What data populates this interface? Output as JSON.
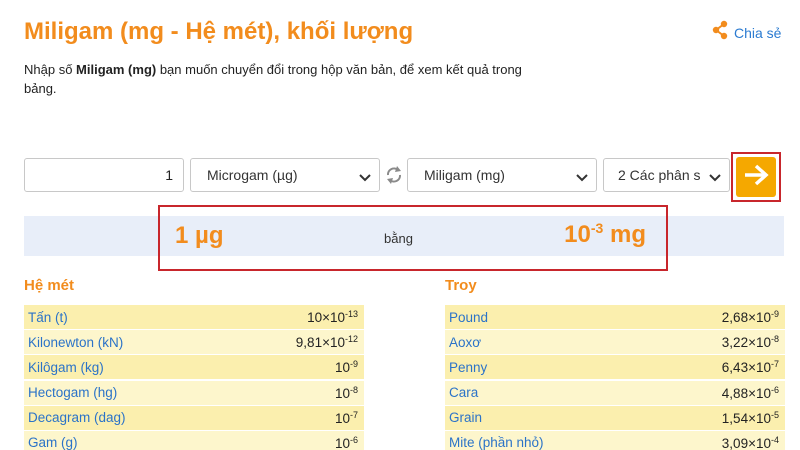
{
  "header": {
    "title": "Miligam (mg - Hệ mét), khối lượng",
    "share_label": "Chia sẻ"
  },
  "intro": {
    "before": "Nhập số ",
    "bold": "Miligam (mg)",
    "after": " bạn muốn chuyển đổi trong hộp văn bản, để xem kết quả trong bảng."
  },
  "converter": {
    "input_value": "1",
    "from_unit": "Microgam (µg)",
    "to_unit": "Miligam (mg)",
    "precision": "2 Các phân s"
  },
  "result": {
    "from_text": "1 µg",
    "equals_label": "bằng",
    "to_base": "10",
    "to_exponent": "-3",
    "to_unit": "mg"
  },
  "metric": {
    "title": "Hệ mét",
    "rows": [
      {
        "unit": "Tấn (t)",
        "mant": "10×10",
        "exp": "-13"
      },
      {
        "unit": "Kilonewton (kN)",
        "mant": "9,81×10",
        "exp": "-12"
      },
      {
        "unit": "Kilôgam (kg)",
        "mant": "10",
        "exp": "-9"
      },
      {
        "unit": "Hectogam (hg)",
        "mant": "10",
        "exp": "-8"
      },
      {
        "unit": "Decagram (dag)",
        "mant": "10",
        "exp": "-7"
      },
      {
        "unit": "Gam (g)",
        "mant": "10",
        "exp": "-6"
      }
    ]
  },
  "troy": {
    "title": "Troy",
    "rows": [
      {
        "unit": "Pound",
        "mant": "2,68×10",
        "exp": "-9"
      },
      {
        "unit": "Aoxơ",
        "mant": "3,22×10",
        "exp": "-8"
      },
      {
        "unit": "Penny",
        "mant": "6,43×10",
        "exp": "-7"
      },
      {
        "unit": "Cara",
        "mant": "4,88×10",
        "exp": "-6"
      },
      {
        "unit": "Grain",
        "mant": "1,54×10",
        "exp": "-5"
      },
      {
        "unit": "Mite (phần nhỏ)",
        "mant": "3,09×10",
        "exp": "-4"
      }
    ]
  },
  "colors": {
    "accent_orange": "#f28c1d",
    "link_blue": "#2b73c8",
    "go_button": "#f5a800",
    "highlight_box": "#c8262c",
    "row_yellow": "#fbefae",
    "result_band": "#e8eef9"
  },
  "icons": {
    "share": "share-icon",
    "swap": "swap-icon",
    "go": "arrow-right-icon",
    "dropdown": "chevron-down-icon"
  }
}
